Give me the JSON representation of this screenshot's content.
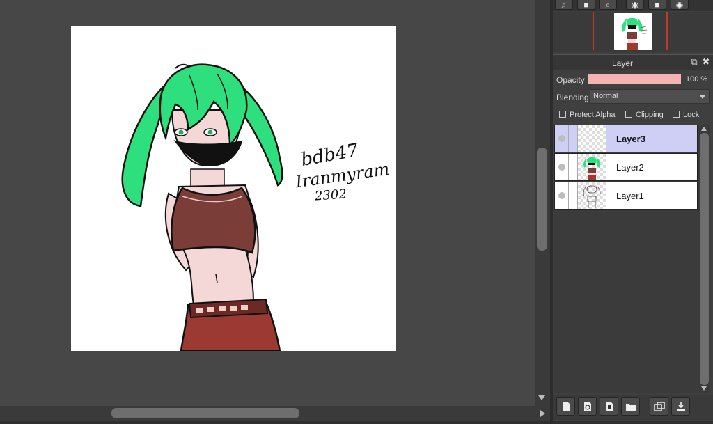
{
  "navigator": {
    "tools": [
      {
        "icon": "zoom-in-icon",
        "glyph": "⌕"
      },
      {
        "icon": "fit-icon",
        "glyph": "■"
      },
      {
        "icon": "zoom-out-icon",
        "glyph": "⌕"
      },
      {
        "icon": "rotate-left-icon",
        "glyph": "◉"
      },
      {
        "icon": "reset-icon",
        "glyph": "■"
      },
      {
        "icon": "rotate-right-icon",
        "glyph": "◉"
      }
    ]
  },
  "layer_panel": {
    "title": "Layer",
    "icons": {
      "float": "⧉",
      "close": "✖"
    },
    "opacity_label": "Opacity",
    "opacity_value": "100 %",
    "opacity_fraction": 1.0,
    "opacity_color": "#f6b3b3",
    "blending_label": "Blending",
    "blending_value": "Normal",
    "checks": {
      "protect_alpha": "Protect Alpha",
      "clipping": "Clipping",
      "lock": "Lock"
    },
    "layers": [
      {
        "name": "Layer3",
        "selected": true
      },
      {
        "name": "Layer2",
        "selected": false
      },
      {
        "name": "Layer1",
        "selected": false
      }
    ],
    "selected_color": "#cfcff6"
  },
  "canvas": {
    "signature": {
      "line1": "bdb47",
      "line2": "Iranmyram",
      "line3": "2302"
    }
  },
  "toolbar_icons": [
    "new-layer-icon",
    "new-layer-copy-icon",
    "new-blank-icon",
    "open-folder-icon",
    "duplicate-layer-icon",
    "merge-down-icon"
  ]
}
